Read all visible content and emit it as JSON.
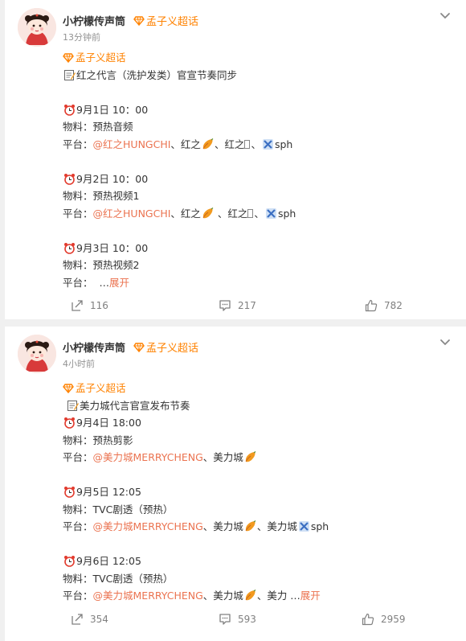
{
  "posts": [
    {
      "author": "小柠檬传声筒",
      "supertopic_tag": "孟子义超话",
      "time": "13分钟前",
      "lines": {
        "l0": "孟子义超话",
        "l1": "红之代言（洗护发类）官宣节奏同步",
        "l2": "9月1日 10：00",
        "l3": "物料：预热音频",
        "l4_prefix": "平台：",
        "l4_mention": "@红之HUNGCHI",
        "l4_rest1": "、红之",
        "l4_rest2": "、红之",
        "l4_rest3": "、",
        "l4_rest4": "sph",
        "l5": "9月2日 10：00",
        "l6": "物料：预热视频1",
        "l7_prefix": "平台：",
        "l7_mention": "@红之HUNGCHI",
        "l7_rest1": "、红之",
        "l7_rest2": " 、红之",
        "l7_rest3": "、",
        "l7_rest4": "sph",
        "l8": "9月3日 10：00",
        "l9": "物料：预热视频2",
        "l10_prefix": "平台：  …",
        "l10_more": "展开"
      },
      "actions": {
        "repost": "116",
        "comment": "217",
        "like": "782"
      }
    },
    {
      "author": "小柠檬传声筒",
      "supertopic_tag": "孟子义超话",
      "time": "4小时前",
      "lines": {
        "l0": "孟子义超话",
        "l1": "美力城代言官宣发布节奏",
        "l2": "9月4日 18:00",
        "l3": "物料：预热剪影",
        "l4_prefix": "平台：",
        "l4_mention": "@美力城MERRYCHENG",
        "l4_rest1": "、美力城",
        "l5": "9月5日 12:05",
        "l6": "物料：TVC剧透（预热）",
        "l7_prefix": "平台：",
        "l7_mention": "@美力城MERRYCHENG",
        "l7_rest1": "、美力城",
        "l7_rest2": "、美力城",
        "l7_rest3": "sph",
        "l8": "9月6日 12:05",
        "l9": "物料：TVC剧透（预热）",
        "l10_prefix": "平台：",
        "l10_mention": "@美力城MERRYCHENG",
        "l10_rest1": "、美力城",
        "l10_rest2": "、美力 …",
        "l10_more": "展开"
      },
      "actions": {
        "repost": "354",
        "comment": "593",
        "like": "2959"
      }
    }
  ],
  "colors": {
    "supertopic": "#ff8200",
    "link": "#eb7350",
    "muted": "#939393",
    "action": "#808080"
  },
  "icons": [
    "diamond-icon",
    "memo-icon",
    "alarm-clock-icon",
    "sweet-potato-icon",
    "sparkle-icon",
    "chevron-down-icon",
    "repost-icon",
    "comment-icon",
    "like-icon"
  ]
}
